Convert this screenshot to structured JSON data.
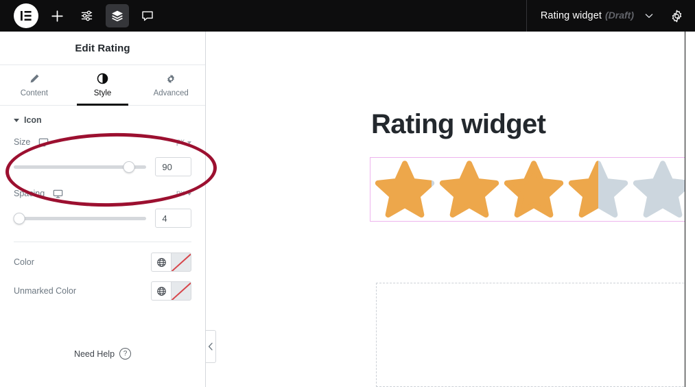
{
  "topbar": {
    "icons": [
      {
        "name": "elementor-logo-icon",
        "label": "Elementor"
      },
      {
        "name": "add-element-icon",
        "label": "Add Element"
      },
      {
        "name": "site-settings-icon",
        "label": "Site Settings"
      },
      {
        "name": "navigator-layers-icon",
        "label": "Navigator"
      },
      {
        "name": "comments-icon",
        "label": "Comments"
      }
    ],
    "document_title": "Rating widget",
    "document_status": "(Draft)",
    "chevron": "⌄",
    "settings_icon_label": "Settings"
  },
  "panel": {
    "header_title": "Edit Rating",
    "tabs": [
      {
        "label": "Content",
        "icon": "pencil-icon",
        "active": false
      },
      {
        "label": "Style",
        "icon": "contrast-half-circle-icon",
        "active": true
      },
      {
        "label": "Advanced",
        "icon": "gear-icon",
        "active": false
      }
    ],
    "section": {
      "title": "Icon",
      "controls": [
        {
          "label": "Size",
          "device_icon": "desktop-icon",
          "unit": "px",
          "value": "90",
          "slider_percent": 87
        },
        {
          "label": "Spacing",
          "device_icon": "desktop-icon",
          "unit": "px",
          "value": "4",
          "slider_percent": 4
        }
      ],
      "colors": [
        {
          "label": "Color",
          "globe_icon": "globe-icon",
          "swatch": "none"
        },
        {
          "label": "Unmarked Color",
          "globe_icon": "globe-icon",
          "swatch": "none"
        }
      ]
    },
    "footer": {
      "need_help": "Need Help",
      "help_icon": "question-mark-icon"
    },
    "collapse_icon": "chevron-left-icon"
  },
  "canvas": {
    "heading": "Rating widget",
    "rating": {
      "value": 3.5,
      "max": 5,
      "icon": "star-icon",
      "marked_color": "#eda74b",
      "unmarked_color": "#ccd6de",
      "selection_border_color": "#eeb3ee"
    },
    "empty_container": "empty-container-dropzone"
  },
  "annotation": {
    "shape": "ellipse",
    "color": "#9c1030",
    "target": "icon-size-control"
  }
}
